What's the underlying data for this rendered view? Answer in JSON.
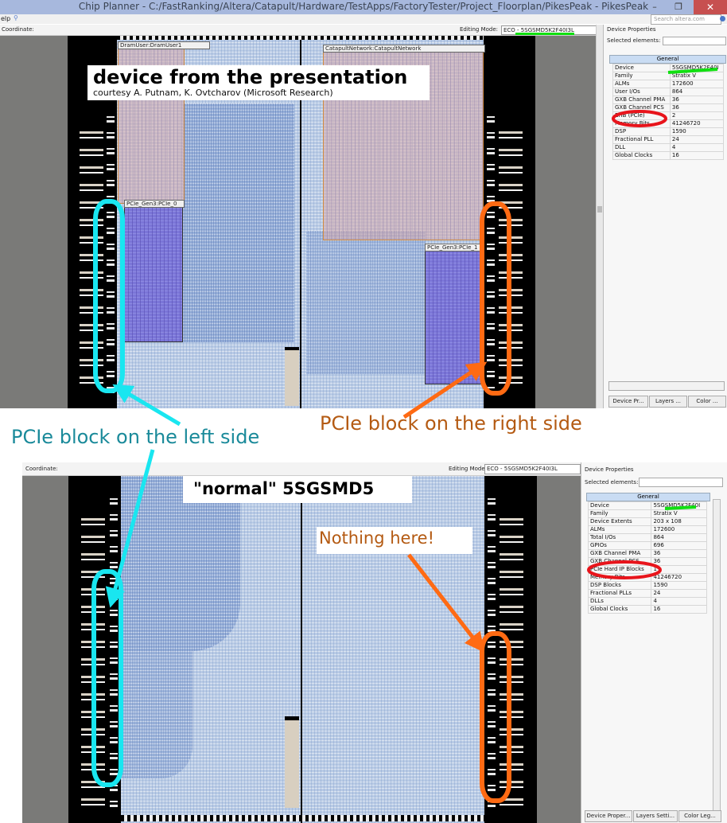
{
  "top_window": {
    "title": "Chip Planner - C:/FastRanking/Altera/Catapult/Hardware/TestApps/FactoryTester/Project_Floorplan/PikesPeak - PikesPeak",
    "window_buttons": [
      "–",
      "❐",
      "✕"
    ],
    "menu_label": "elp",
    "search_placeholder": "Search altera.com",
    "toolbar": {
      "coordinate_label": "Coordinate:",
      "editing_mode_label": "Editing Mode:",
      "editing_mode_value": "ECO - 5SGSMD5K2F40I3L"
    },
    "properties_panel": {
      "title": "Device Properties",
      "selected_label": "Selected elements:",
      "section": "General",
      "rows": [
        {
          "k": "Device",
          "v": "5SGSMD5K2F40I"
        },
        {
          "k": "Family",
          "v": "Stratix V"
        },
        {
          "k": "ALMs",
          "v": "172600"
        },
        {
          "k": "User I/Os",
          "v": "864"
        },
        {
          "k": "GXB Channel PMA",
          "v": "36"
        },
        {
          "k": "GXB Channel PCS",
          "v": "36"
        },
        {
          "k": "EHB (PCIe)",
          "v": "2"
        },
        {
          "k": "Memory Bits",
          "v": "41246720"
        },
        {
          "k": "DSP",
          "v": "1590"
        },
        {
          "k": "Fractional PLL",
          "v": "24"
        },
        {
          "k": "DLL",
          "v": "4"
        },
        {
          "k": "Global Clocks",
          "v": "16"
        }
      ],
      "tabs": [
        "Device Pr...",
        "Layers ...",
        "Color ..."
      ]
    },
    "regions": {
      "dram": "DramUser:DramUser1",
      "catapult": "CatapultNetwork:CatapultNetwork",
      "pcie_left": "PCIe_Gen3:PCIe_0",
      "pcie_right": "PCIe_Gen3:PCIe_1"
    },
    "banner_title": "device from the presentation",
    "banner_sub": "courtesy A. Putnam, K. Ovtcharov (Microsoft Research)"
  },
  "annotations": {
    "left": "PCIe block on the left side",
    "right": "PCIe block on the right side",
    "nothing": "Nothing here!",
    "normal": "\"normal\" 5SGSMD5",
    "colors": {
      "cyan": "#19e6f0",
      "orange": "#ff6a13",
      "red": "#e8141b",
      "green": "#11e011",
      "teal_text": "#1a8a9a",
      "brown_text": "#b45a12"
    }
  },
  "bottom_window": {
    "toolbar": {
      "coordinate_label": "Coordinate:",
      "editing_mode_label": "Editing Mode:",
      "editing_mode_value": "ECO - 5SGSMD5K2F40I3L"
    },
    "properties_panel": {
      "title": "Device Properties",
      "selected_label": "Selected elements:",
      "section": "General",
      "rows": [
        {
          "k": "Device",
          "v": "5SGSMD5K2F40I"
        },
        {
          "k": "Family",
          "v": "Stratix V"
        },
        {
          "k": "Device Extents",
          "v": "203 x 108"
        },
        {
          "k": "ALMs",
          "v": "172600"
        },
        {
          "k": "Total I/Os",
          "v": "864"
        },
        {
          "k": "GPIOs",
          "v": "696"
        },
        {
          "k": "GXB Channel PMA",
          "v": "36"
        },
        {
          "k": "GXB Channel PCS",
          "v": "36"
        },
        {
          "k": "PCIe Hard IP Blocks",
          "v": "1"
        },
        {
          "k": "Memory Bits",
          "v": "41246720"
        },
        {
          "k": "DSP Blocks",
          "v": "1590"
        },
        {
          "k": "Fractional PLLs",
          "v": "24"
        },
        {
          "k": "DLLs",
          "v": "4"
        },
        {
          "k": "Global Clocks",
          "v": "16"
        }
      ],
      "tabs": [
        "Device Proper...",
        "Layers Setti...",
        "Color Leg..."
      ]
    }
  }
}
